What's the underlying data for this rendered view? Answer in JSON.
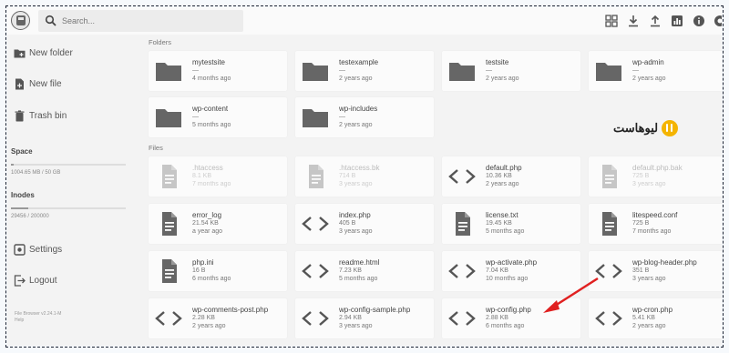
{
  "search": {
    "placeholder": "Search..."
  },
  "header": {
    "icons": [
      "grid-view-icon",
      "download-icon",
      "upload-icon",
      "info-chart-icon",
      "info-icon",
      "more-icon"
    ]
  },
  "sidebar": {
    "new_folder": "New folder",
    "new_file": "New file",
    "trash_bin": "Trash bin",
    "space_label": "Space",
    "space_value": "1004.65 MB / 50 GB",
    "space_fraction": 0.02,
    "inodes_label": "Inodes",
    "inodes_value": "29456 / 200000",
    "inodes_fraction": 0.147,
    "settings": "Settings",
    "logout": "Logout",
    "version": "File Browser v2.24.1-M",
    "help": "Help"
  },
  "sections": {
    "folders": "Folders",
    "files": "Files"
  },
  "folders": [
    {
      "name": "mytestsite",
      "size": "—",
      "modified": "4 months ago"
    },
    {
      "name": "testexample",
      "size": "—",
      "modified": "2 years ago"
    },
    {
      "name": "testsite",
      "size": "—",
      "modified": "2 years ago"
    },
    {
      "name": "wp-admin",
      "size": "—",
      "modified": "2 years ago"
    },
    {
      "name": "wp-content",
      "size": "—",
      "modified": "5 months ago"
    },
    {
      "name": "wp-includes",
      "size": "—",
      "modified": "2 years ago"
    }
  ],
  "files": [
    {
      "name": ".htaccess",
      "size": "8.1 KB",
      "modified": "7 months ago",
      "type": "doc",
      "faded": true
    },
    {
      "name": ".htaccess.bk",
      "size": "714 B",
      "modified": "3 years ago",
      "type": "doc",
      "faded": true
    },
    {
      "name": "default.php",
      "size": "10.36 KB",
      "modified": "2 years ago",
      "type": "code",
      "faded": false
    },
    {
      "name": "default.php.bak",
      "size": "725 B",
      "modified": "3 years ago",
      "type": "doc",
      "faded": true
    },
    {
      "name": "error_log",
      "size": "21.54 KB",
      "modified": "a year ago",
      "type": "doc",
      "faded": false
    },
    {
      "name": "index.php",
      "size": "405 B",
      "modified": "3 years ago",
      "type": "code",
      "faded": false
    },
    {
      "name": "license.txt",
      "size": "19.45 KB",
      "modified": "5 months ago",
      "type": "doc",
      "faded": false
    },
    {
      "name": "litespeed.conf",
      "size": "725 B",
      "modified": "7 months ago",
      "type": "doc",
      "faded": false
    },
    {
      "name": "php.ini",
      "size": "16 B",
      "modified": "6 months ago",
      "type": "doc",
      "faded": false
    },
    {
      "name": "readme.html",
      "size": "7.23 KB",
      "modified": "5 months ago",
      "type": "code",
      "faded": false
    },
    {
      "name": "wp-activate.php",
      "size": "7.04 KB",
      "modified": "10 months ago",
      "type": "code",
      "faded": false
    },
    {
      "name": "wp-blog-header.php",
      "size": "351 B",
      "modified": "3 years ago",
      "type": "code",
      "faded": false
    },
    {
      "name": "wp-comments-post.php",
      "size": "2.28 KB",
      "modified": "2 years ago",
      "type": "code",
      "faded": false
    },
    {
      "name": "wp-config-sample.php",
      "size": "2.94 KB",
      "modified": "3 years ago",
      "type": "code",
      "faded": false
    },
    {
      "name": "wp-config.php",
      "size": "2.88 KB",
      "modified": "6 months ago",
      "type": "code",
      "faded": false
    },
    {
      "name": "wp-cron.php",
      "size": "5.41 KB",
      "modified": "2 years ago",
      "type": "code",
      "faded": false
    }
  ],
  "watermark": {
    "text": "لیوهاست"
  },
  "colors": {
    "accent_arrow": "#e02020",
    "brand_logo": "#f4b400",
    "icon_gray": "#666666"
  }
}
